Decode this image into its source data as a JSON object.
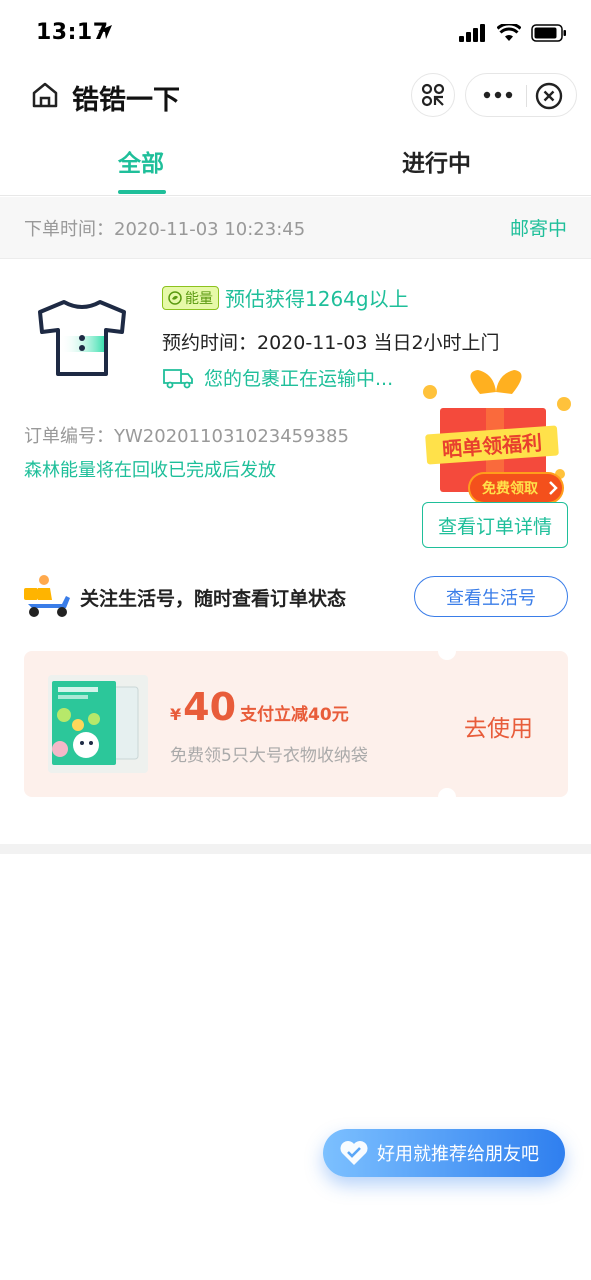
{
  "status_bar": {
    "time": "13:17"
  },
  "nav": {
    "title": "锆锆一下"
  },
  "tabs": {
    "all": "全部",
    "in_progress": "进行中"
  },
  "order": {
    "time": "下单时间：2020-11-03 10:23:45",
    "status": "邮寄中",
    "energy_badge": "能量",
    "energy_estimate": "预估获得1264g以上",
    "appointment": "预约时间：2020-11-03 当日2小时上门",
    "shipping": "您的包裹正在运输中...",
    "order_no": "订单编号：YW202011031023459385",
    "forest_note": "森林能量将在回收已完成后发放",
    "detail_button": "查看订单详情"
  },
  "gift": {
    "banner": "晒单领福利",
    "cta": "免费领取"
  },
  "follow": {
    "text": "关注生活号，随时查看订单状态",
    "button": "查看生活号"
  },
  "coupon": {
    "yen": "¥",
    "amount": "40",
    "desc": "支付立减40元",
    "sub": "免费领5只大号衣物收纳袋",
    "use": "去使用"
  },
  "recommend": {
    "label": "好用就推荐给朋友吧"
  },
  "colors": {
    "accent": "#1fbf9a",
    "coupon": "#e85c3a",
    "link": "#3a7de8"
  }
}
